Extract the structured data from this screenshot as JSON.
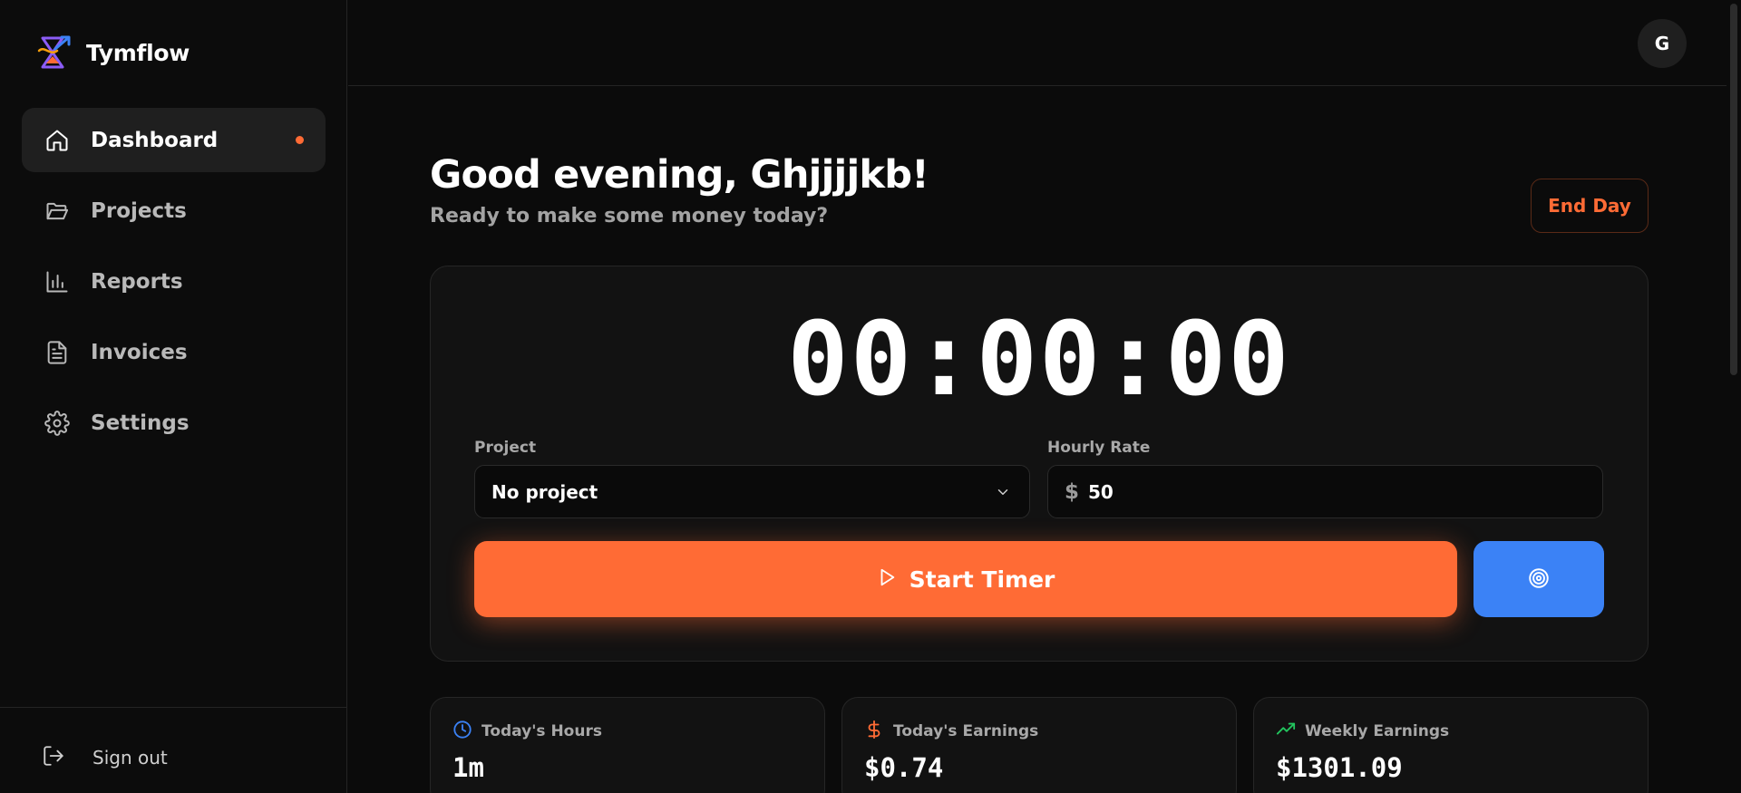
{
  "brand": {
    "name": "Tymflow"
  },
  "sidebar": {
    "items": [
      {
        "label": "Dashboard",
        "icon": "home-icon",
        "active": true
      },
      {
        "label": "Projects",
        "icon": "folder-icon",
        "active": false
      },
      {
        "label": "Reports",
        "icon": "bar-chart-icon",
        "active": false
      },
      {
        "label": "Invoices",
        "icon": "document-icon",
        "active": false
      },
      {
        "label": "Settings",
        "icon": "gear-icon",
        "active": false
      }
    ],
    "signout_label": "Sign out"
  },
  "topbar": {
    "avatar_initial": "G"
  },
  "main": {
    "greeting": "Good evening, Ghjjjjkb!",
    "subtitle": "Ready to make some money today?",
    "end_day_label": "End Day",
    "timer": {
      "display": "00:00:00",
      "project_label": "Project",
      "project_value": "No project",
      "rate_label": "Hourly Rate",
      "currency_symbol": "$",
      "rate_value": "50",
      "start_label": "Start Timer"
    },
    "stats": [
      {
        "title": "Today's Hours",
        "value": "1m",
        "icon": "clock-icon",
        "color": "#3b82f6"
      },
      {
        "title": "Today's Earnings",
        "value": "$0.74",
        "icon": "dollar-icon",
        "color": "#ff6b35"
      },
      {
        "title": "Weekly Earnings",
        "value": "$1301.09",
        "icon": "trending-up-icon",
        "color": "#22c55e"
      }
    ]
  },
  "colors": {
    "accent": "#ff6b35",
    "focus_button": "#3b82f6",
    "background": "#0b0b0b",
    "card": "#121212"
  }
}
